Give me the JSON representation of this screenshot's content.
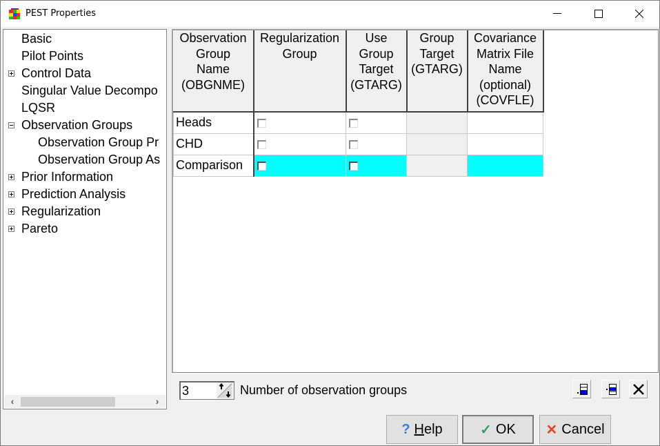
{
  "window": {
    "title": "PEST Properties",
    "controls": {
      "minimize": "minimize-icon",
      "maximize": "maximize-icon",
      "close": "close-icon"
    }
  },
  "tree": {
    "items": [
      {
        "label": "Basic",
        "level": 0,
        "expander": "none"
      },
      {
        "label": "Pilot Points",
        "level": 0,
        "expander": "none"
      },
      {
        "label": "Control Data",
        "level": 0,
        "expander": "plus"
      },
      {
        "label": "Singular Value Decompo",
        "level": 0,
        "expander": "none"
      },
      {
        "label": "LQSR",
        "level": 0,
        "expander": "none"
      },
      {
        "label": "Observation Groups",
        "level": 0,
        "expander": "minus"
      },
      {
        "label": "Observation Group Pr",
        "level": 1,
        "expander": "none"
      },
      {
        "label": "Observation Group As",
        "level": 1,
        "expander": "none"
      },
      {
        "label": "Prior Information",
        "level": 0,
        "expander": "plus"
      },
      {
        "label": "Prediction Analysis",
        "level": 0,
        "expander": "plus"
      },
      {
        "label": "Regularization",
        "level": 0,
        "expander": "plus"
      },
      {
        "label": "Pareto",
        "level": 0,
        "expander": "plus"
      }
    ],
    "scroll_left": "‹",
    "scroll_right": "›"
  },
  "grid": {
    "columns": [
      {
        "lines": [
          "Observation",
          "Group",
          "Name",
          "(OBGNME)"
        ]
      },
      {
        "lines": [
          "Regularization",
          "Group"
        ]
      },
      {
        "lines": [
          "Use",
          "Group",
          "Target",
          "(GTARG)"
        ]
      },
      {
        "lines": [
          "Group",
          "Target",
          "(GTARG)"
        ]
      },
      {
        "lines": [
          "Covariance",
          "Matrix File",
          "Name",
          "(optional)",
          "(COVFLE)"
        ]
      }
    ],
    "rows": [
      {
        "name": "Heads",
        "regularization": false,
        "use_target": false,
        "target": "",
        "covfle": "",
        "selected": false
      },
      {
        "name": "CHD",
        "regularization": false,
        "use_target": false,
        "target": "",
        "covfle": "",
        "selected": false
      },
      {
        "name": "Comparison",
        "regularization": false,
        "use_target": false,
        "target": "",
        "covfle": "",
        "selected": true
      }
    ],
    "selection_color": "#00ffff"
  },
  "bottom": {
    "count_value": "3",
    "count_label": "Number of observation groups",
    "tools": [
      "insert-row-before-icon",
      "insert-row-after-icon",
      "delete-row-icon"
    ]
  },
  "footer": {
    "help": {
      "glyph": "?",
      "label_underlined": "H",
      "label_rest": "elp"
    },
    "ok": {
      "glyph": "✓",
      "label": "OK"
    },
    "cancel": {
      "glyph": "✕",
      "label": "Cancel"
    }
  }
}
